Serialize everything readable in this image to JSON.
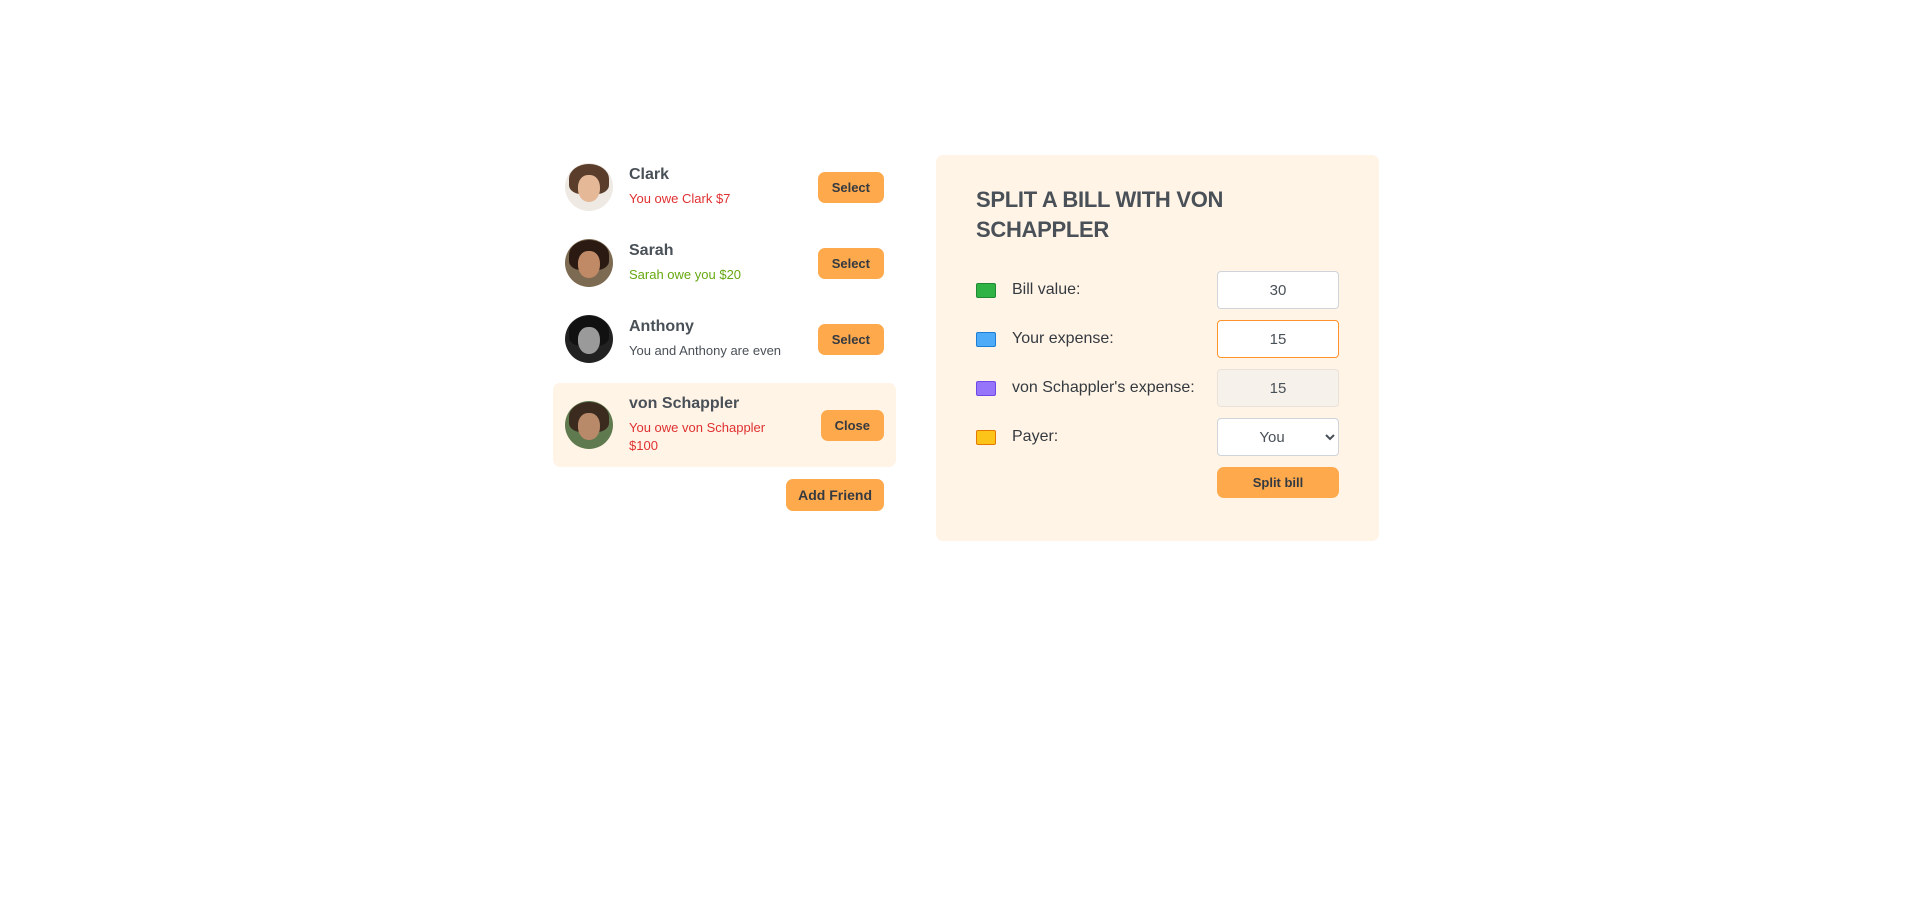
{
  "friends": [
    {
      "name": "Clark",
      "balance": "You owe Clark $7",
      "status": "owe",
      "button": "Select"
    },
    {
      "name": "Sarah",
      "balance": "Sarah owe you $20",
      "status": "owed",
      "button": "Select"
    },
    {
      "name": "Anthony",
      "balance": "You and Anthony are even",
      "status": "even",
      "button": "Select"
    },
    {
      "name": "von Schappler",
      "balance": "You owe von Schappler $100",
      "status": "owe",
      "button": "Close"
    }
  ],
  "sidebar": {
    "add_friend_label": "Add Friend"
  },
  "form": {
    "title": "SPLIT A BILL WITH VON SCHAPPLER",
    "bill_value_label": "Bill value:",
    "bill_value": "30",
    "your_expense_label": "Your expense:",
    "your_expense": "15",
    "friend_expense_label": "von Schappler's expense:",
    "friend_expense": "15",
    "payer_label": "Payer:",
    "payer_selected": "You",
    "split_button": "Split bill"
  },
  "icons": {
    "bill_value": "money-green-icon",
    "your_expense": "money-blue-icon",
    "friend_expense": "money-purple-icon",
    "payer": "money-yellow-icon"
  },
  "colors": {
    "accent": "#ffa94d",
    "selected_bg": "#fff4e6",
    "owe": "#e03131",
    "owed": "#66a80f"
  }
}
